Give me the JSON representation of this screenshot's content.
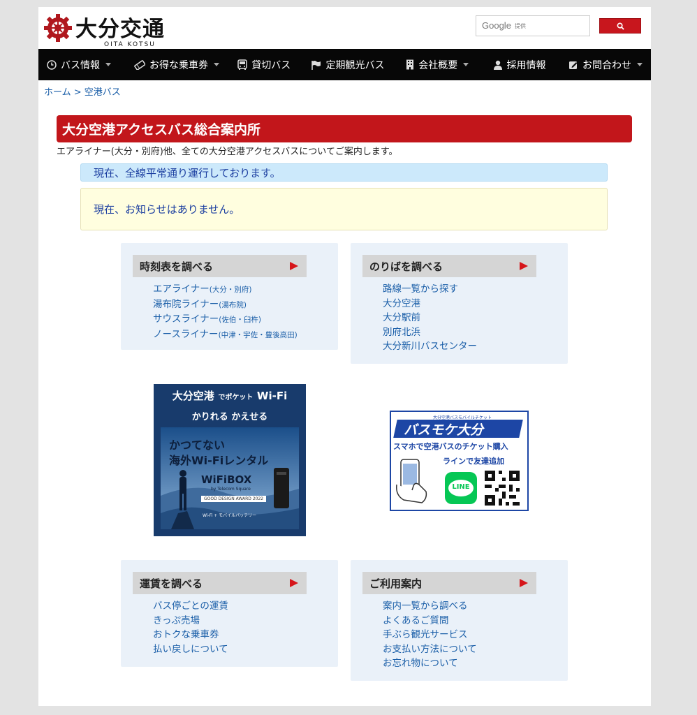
{
  "header": {
    "logo_jp": "大分交通",
    "logo_en": "OITA KOTSU",
    "search": {
      "google_label": "Google",
      "provided_label": "提供"
    },
    "colors": {
      "brand_red": "#c2161b",
      "nav_bg": "#070707",
      "link": "#1a5ea8"
    }
  },
  "nav": [
    {
      "label": "バス情報",
      "icon": "clock-icon",
      "dropdown": true
    },
    {
      "label": "お得な乗車券",
      "icon": "ticket-icon",
      "dropdown": true
    },
    {
      "label": "貸切バス",
      "icon": "bus-icon",
      "dropdown": false
    },
    {
      "label": "定期観光バス",
      "icon": "flag-icon",
      "dropdown": false
    },
    {
      "label": "会社概要",
      "icon": "building-icon",
      "dropdown": true
    },
    {
      "label": "採用情報",
      "icon": "person-icon",
      "dropdown": false
    },
    {
      "label": "お問合わせ",
      "icon": "edit-icon",
      "dropdown": true
    }
  ],
  "breadcrumb": {
    "home": "ホーム",
    "sep": " > ",
    "current": "空港バス"
  },
  "main": {
    "title": "大分空港アクセスバス総合案内所",
    "subtitle": "エアライナー(大分・別府)他、全ての大分空港アクセスバスについてご案内します。",
    "status": "現在、全線平常通り運行しております。",
    "notice": "現在、お知らせはありません。"
  },
  "boxes": {
    "timetable": {
      "title": "時刻表を調べる",
      "items": [
        {
          "name": "エアライナー",
          "sub": "(大分・別府)"
        },
        {
          "name": "湯布院ライナー",
          "sub": "(湯布院)"
        },
        {
          "name": "サウスライナー",
          "sub": "(佐伯・臼杵)"
        },
        {
          "name": "ノースライナー",
          "sub": "(中津・宇佐・豊後高田)"
        }
      ]
    },
    "platform": {
      "title": "のりばを調べる",
      "items": [
        "路線一覧から探す",
        "大分空港",
        "大分駅前",
        "別府北浜",
        "大分新川バスセンター"
      ]
    },
    "fare": {
      "title": "運賃を調べる",
      "items": [
        "バス停ごとの運賃",
        "きっぷ売場",
        "おトクな乗車券",
        "払い戻しについて"
      ]
    },
    "guide": {
      "title": "ご利用案内",
      "items": [
        "案内一覧から調べる",
        "よくあるご質問",
        "手ぶら観光サービス",
        "お支払い方法について",
        "お忘れ物について"
      ]
    }
  },
  "banners": {
    "wifi": {
      "line1a": "大分空港",
      "line1b": "でポケット",
      "line1c": "Wi-Fi",
      "line2": "かりれる かえせる",
      "headline1": "かつてない",
      "headline2": "海外Wi-Fiレンタル",
      "brand": "WiFiBOX",
      "brand_sub": "by Telecom Square",
      "award": "GOOD DESIGN AWARD 2022",
      "tag": "Wi-Fi + モバイルバッテリー"
    },
    "mobile": {
      "top": "大分空港バスモバイルチケット",
      "logo": "バスモケ大分",
      "line1": "スマホで空港バスのチケット購入",
      "line2": "ラインで友達追加",
      "line_logo": "LINE"
    }
  }
}
